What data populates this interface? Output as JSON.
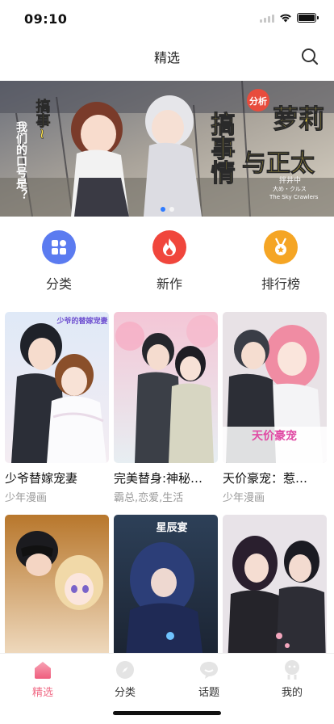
{
  "status_bar": {
    "time": "09:10"
  },
  "nav": {
    "title": "精选"
  },
  "banner": {
    "title_left": "搞事情",
    "slogan_top": "搞事~",
    "slogan": "我们的口号是？",
    "badge": "分析",
    "title_right_1": "萝莉",
    "title_right_2": "与正太",
    "credit_1": "拌井中",
    "credit_2": "大め・クルス",
    "credit_3": "The Sky Crawlers",
    "slide_count": 2,
    "active_slide": 1
  },
  "quick_links": [
    {
      "label": "分类",
      "icon": "grid-icon",
      "color": "#5b7bf0"
    },
    {
      "label": "新作",
      "icon": "flame-icon",
      "color": "#f0463c"
    },
    {
      "label": "排行榜",
      "icon": "medal-icon",
      "color": "#f5a524"
    }
  ],
  "comics": [
    {
      "title": "少爷替嫁宠妻",
      "tags": "少年漫画",
      "cover_text": "少爷的替嫁宠妻"
    },
    {
      "title": "完美替身:神秘…",
      "tags": "霸总,恋爱,生活",
      "cover_text": ""
    },
    {
      "title": "天价豪宠：惹…",
      "tags": "少年漫画",
      "cover_text": "天价豪宠"
    },
    {
      "title": "",
      "tags": "",
      "cover_text": ""
    },
    {
      "title": "",
      "tags": "",
      "cover_text": "星辰宴"
    },
    {
      "title": "",
      "tags": "",
      "cover_text": ""
    }
  ],
  "tabs": [
    {
      "label": "精选",
      "icon": "home-icon",
      "active": true
    },
    {
      "label": "分类",
      "icon": "compass-icon",
      "active": false
    },
    {
      "label": "话题",
      "icon": "chat-icon",
      "active": false
    },
    {
      "label": "我的",
      "icon": "profile-icon",
      "active": false
    }
  ],
  "colors": {
    "accent": "#f06b86",
    "indicator": "#2f7bff"
  }
}
